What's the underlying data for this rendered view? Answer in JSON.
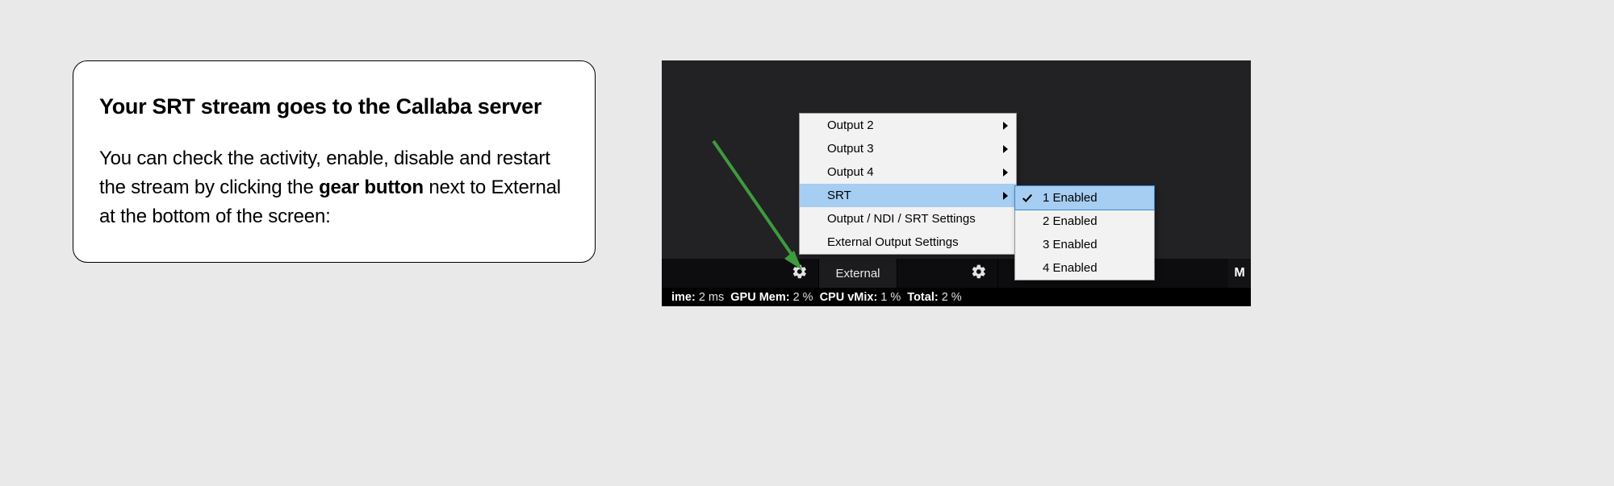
{
  "card": {
    "heading": "Your SRT stream goes to the Callaba server",
    "body_before": "You can check the activity, enable, disable and restart the stream by clicking the ",
    "body_bold": "gear button",
    "body_after": " next to External at the bottom of the screen:"
  },
  "menu": {
    "items": [
      {
        "label": "Output 2",
        "has_sub": true,
        "selected": false
      },
      {
        "label": "Output 3",
        "has_sub": true,
        "selected": false
      },
      {
        "label": "Output 4",
        "has_sub": true,
        "selected": false
      },
      {
        "label": "SRT",
        "has_sub": true,
        "selected": true
      },
      {
        "label": "Output / NDI / SRT Settings",
        "has_sub": false,
        "selected": false
      },
      {
        "label": "External Output Settings",
        "has_sub": false,
        "selected": false
      }
    ]
  },
  "submenu": {
    "items": [
      {
        "label": "1 Enabled",
        "checked": true,
        "selected": true
      },
      {
        "label": "2 Enabled",
        "checked": false,
        "selected": false
      },
      {
        "label": "3 Enabled",
        "checked": false,
        "selected": false
      },
      {
        "label": "4 Enabled",
        "checked": false,
        "selected": false
      }
    ]
  },
  "toolbar": {
    "external_label": "External",
    "right_letter": "M"
  },
  "status": {
    "k1": "ime:",
    "v1": "2 ms",
    "k2": "GPU Mem:",
    "v2": "2 %",
    "k3": "CPU vMix:",
    "v3": "1 %",
    "k4": "Total:",
    "v4": "2 %"
  }
}
